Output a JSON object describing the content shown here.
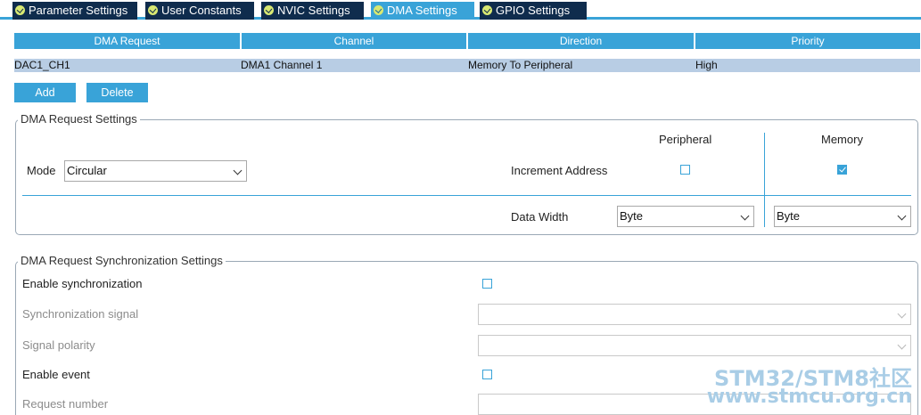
{
  "tabs": [
    {
      "label": "Parameter Settings",
      "active": false
    },
    {
      "label": "User Constants",
      "active": false
    },
    {
      "label": "NVIC Settings",
      "active": false
    },
    {
      "label": "DMA Settings",
      "active": true
    },
    {
      "label": "GPIO Settings",
      "active": false
    }
  ],
  "dma_table": {
    "headers": [
      "DMA Request",
      "Channel",
      "Direction",
      "Priority"
    ],
    "rows": [
      [
        "DAC1_CH1",
        "DMA1 Channel 1",
        "Memory To Peripheral",
        "High"
      ]
    ]
  },
  "buttons": {
    "add": "Add",
    "delete": "Delete"
  },
  "request_settings": {
    "legend": "DMA Request Settings",
    "mode_label": "Mode",
    "mode_value": "Circular",
    "peripheral_header": "Peripheral",
    "memory_header": "Memory",
    "increment_label": "Increment Address",
    "peripheral_increment": false,
    "memory_increment": true,
    "data_width_label": "Data Width",
    "peripheral_width": "Byte",
    "memory_width": "Byte"
  },
  "sync_settings": {
    "legend": "DMA Request Synchronization Settings",
    "enable_sync_label": "Enable synchronization",
    "sync_signal_label": "Synchronization signal",
    "signal_polarity_label": "Signal polarity",
    "enable_event_label": "Enable event",
    "request_number_label": "Request number"
  },
  "watermark": {
    "line1": "STM32/STM8社区",
    "line2": "www.stmcu.org.cn"
  },
  "colors": {
    "accent": "#39a3d8",
    "tab_dark": "#0f2c4d",
    "row_selected": "#b8cde4"
  }
}
